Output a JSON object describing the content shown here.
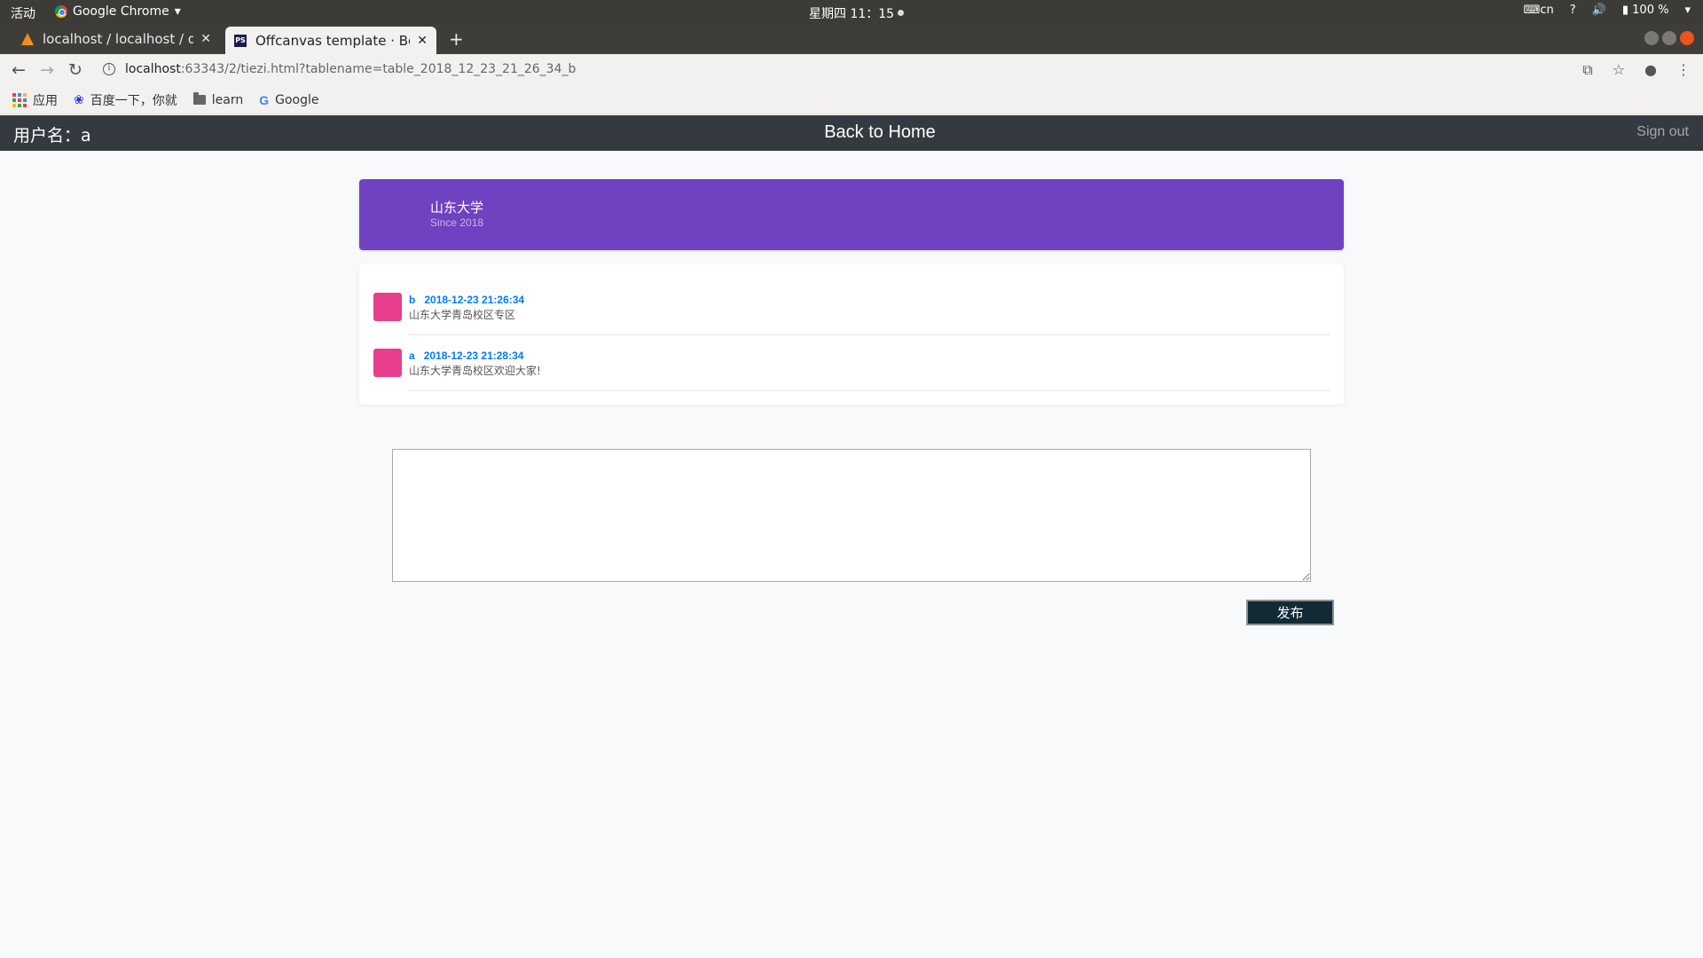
{
  "os": {
    "activities": "活动",
    "app_name": "Google Chrome",
    "clock": "星期四 11：15",
    "input_method": "cn",
    "battery": "100 %"
  },
  "browser": {
    "tabs": [
      {
        "title": "localhost / localhost / dat",
        "active": false
      },
      {
        "title": "Offcanvas template · Boo",
        "active": true
      }
    ],
    "url_host": "localhost",
    "url_rest": ":63343/2/tiezi.html?tablename=table_2018_12_23_21_26_34_b",
    "bookmarks": [
      {
        "label": "应用",
        "icon": "apps-grid-icon"
      },
      {
        "label": "百度一下，你就",
        "icon": "baidu-paw-icon"
      },
      {
        "label": "learn",
        "icon": "folder-icon"
      },
      {
        "label": "Google",
        "icon": "google-g-icon"
      }
    ]
  },
  "navbar": {
    "user_label": "用户名：a",
    "home_link": "Back to Home",
    "signout_link": "Sign out"
  },
  "header": {
    "name": "山东大学",
    "since": "Since 2018",
    "color": "#6f42c1"
  },
  "posts": [
    {
      "user": "b",
      "time": "2018-12-23 21:26:34",
      "text": "山东大学青岛校区专区",
      "avatar_color": "#e83e8c"
    },
    {
      "user": "a",
      "time": "2018-12-23 21:28:34",
      "text": "山东大学青岛校区欢迎大家!",
      "avatar_color": "#e83e8c"
    }
  ],
  "composer": {
    "value": "",
    "submit_label": "发布"
  }
}
